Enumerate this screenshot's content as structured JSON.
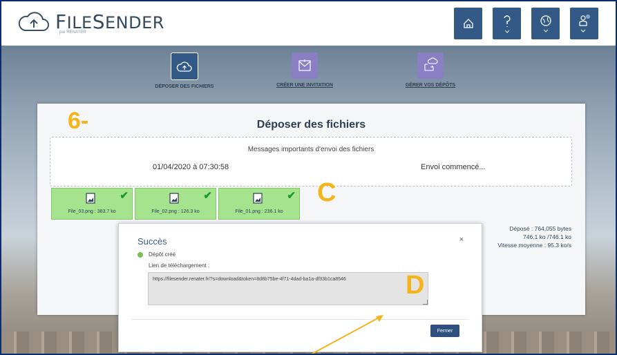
{
  "app": {
    "brand": "FileSender",
    "brand_first": "F",
    "brand_rest": "ILE",
    "brand_first2": "S",
    "brand_rest2": "ENDER",
    "tagline": "par RENATER"
  },
  "header": {
    "buttons": [
      "home-icon",
      "help-icon",
      "language-icon",
      "user-icon"
    ]
  },
  "nav": {
    "items": [
      {
        "label": "Déposer des fichiers",
        "icon": "upload-cloud-icon",
        "active": true
      },
      {
        "label": "Créer une invitation",
        "icon": "invitation-icon",
        "active": false
      },
      {
        "label": "Gérer vos dépôts",
        "icon": "manage-transfers-icon",
        "active": false
      }
    ]
  },
  "annotations": {
    "step": "6-",
    "c": "C",
    "d": "D"
  },
  "panel": {
    "title": "Déposer des fichiers",
    "messages_title": "Messages importants d'envoi des fichiers",
    "date": "01/04/2020 à 07:30:58",
    "status": "Envoi commencé..."
  },
  "files": [
    {
      "name": "File_03.png : 383.7 ko"
    },
    {
      "name": "File_02.png : 126.3 ko"
    },
    {
      "name": "File_01.png : 236.1 ko"
    }
  ],
  "stats": {
    "uploaded": "Déposé : 764,055 bytes",
    "size": "746.1 ko /746.1 ko",
    "speed": "Vitesse moyenne : 95.3 ko/s"
  },
  "modal": {
    "title": "Succès",
    "close": "×",
    "created": "Dépôt créé",
    "link_label": "Lien de téléchargement :",
    "link": "https://filesender.renater.fr/?s=download&token=8d8b75be-4f71-4dad-ba1a-df33b1ca8546",
    "button": "Fermer"
  },
  "colors": {
    "header_button": "#335a86",
    "nav_active": "#335a86",
    "nav_inactive": "#8b7fc4",
    "file_ok": "#a6e38f",
    "annotation": "#f4b41a"
  }
}
